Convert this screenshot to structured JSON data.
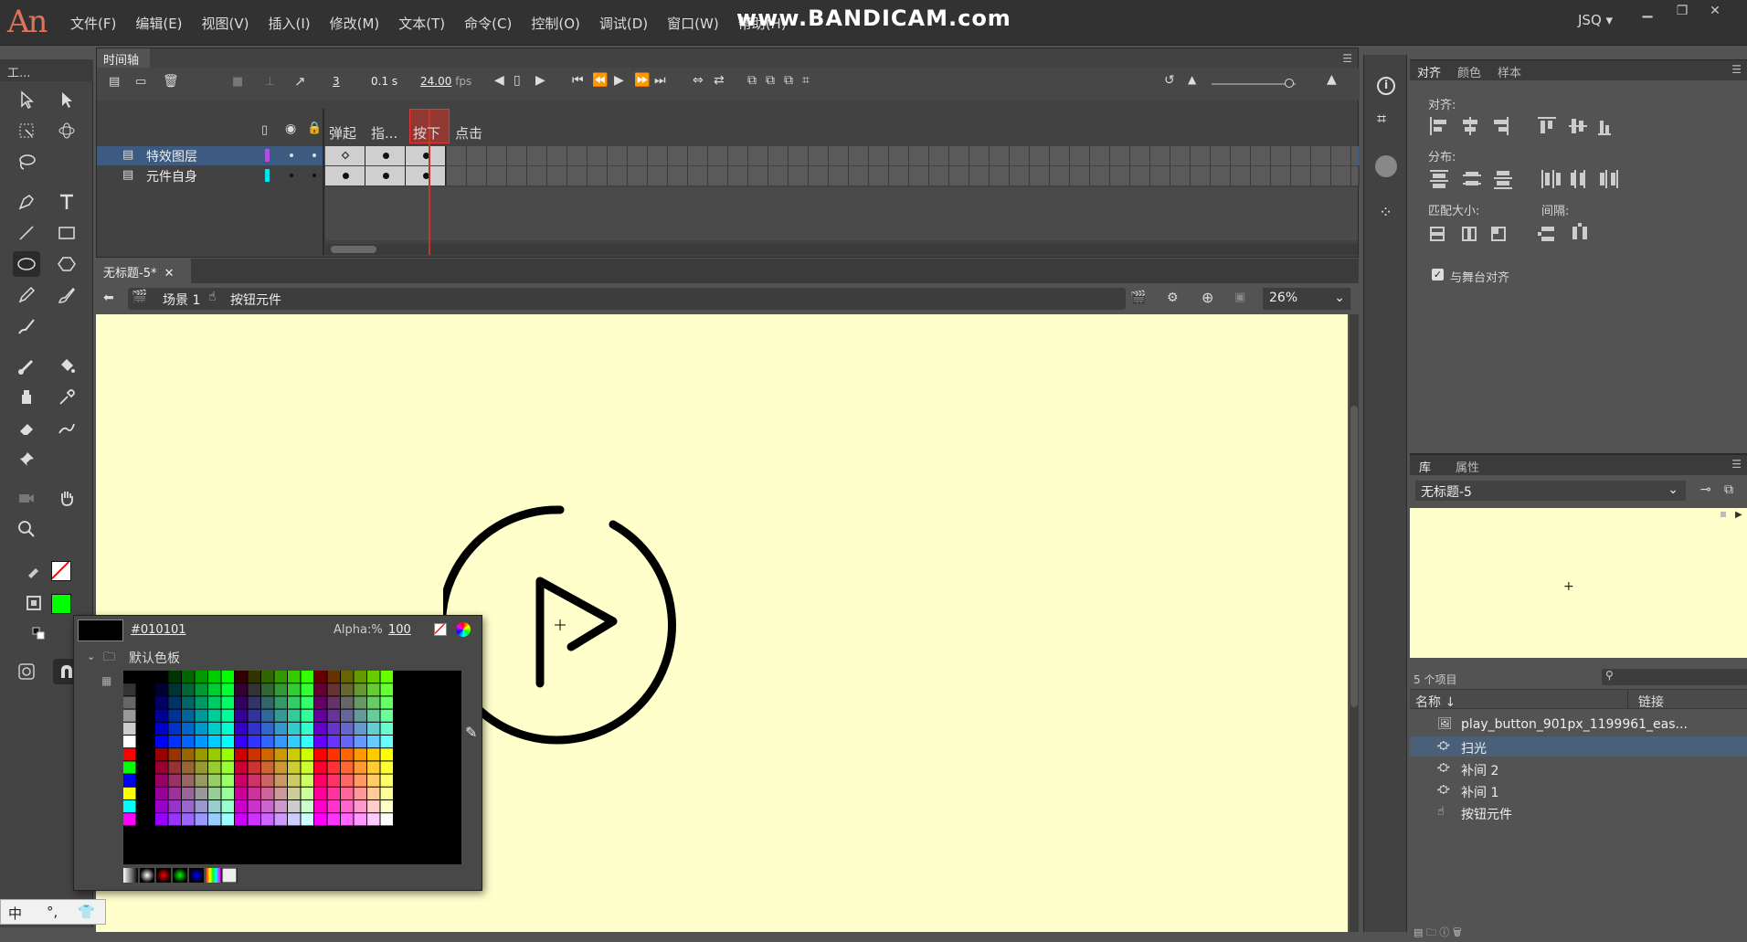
{
  "menubar": {
    "logo": "An",
    "items": [
      "文件(F)",
      "编辑(E)",
      "视图(V)",
      "插入(I)",
      "修改(M)",
      "文本(T)",
      "命令(C)",
      "控制(O)",
      "调试(D)",
      "窗口(W)",
      "帮助(H)"
    ],
    "watermark": "www.BANDICAM.com",
    "user": "JSQ"
  },
  "tools": {
    "header": "工..."
  },
  "timeline": {
    "tab": "时间轴",
    "current_frame": "3",
    "time": "0.1 s",
    "fps": "24.00",
    "fps_unit": "fps",
    "frame_labels": [
      "弹起",
      "指...",
      "按下",
      "点击"
    ],
    "layers": [
      {
        "name": "特效图层",
        "selected": true,
        "color": "#b050e0"
      },
      {
        "name": "元件自身",
        "selected": false,
        "color": "#00e5ee"
      }
    ]
  },
  "document": {
    "tab": "无标题-5*",
    "scene": "场景 1",
    "symbol": "按钮元件",
    "zoom": "26%"
  },
  "swatch": {
    "hex": "#010101",
    "alpha_label": "Alpha:%",
    "alpha": "100",
    "folder": "默认色板"
  },
  "align": {
    "tabs": [
      "对齐",
      "颜色",
      "样本"
    ],
    "align_label": "对齐:",
    "distribute_label": "分布:",
    "match_label": "匹配大小:",
    "spacing_label": "间隔:",
    "stage_align": "与舞台对齐"
  },
  "library": {
    "tabs": [
      "库",
      "属性"
    ],
    "doc": "无标题-5",
    "count": "5 个项目",
    "col_name": "名称",
    "col_link": "链接",
    "items": [
      {
        "name": "play_button_901px_1199961_eas...",
        "icon": "bitmap-icon",
        "selected": false
      },
      {
        "name": "扫光",
        "icon": "graphic-symbol-icon",
        "selected": true
      },
      {
        "name": "补间 2",
        "icon": "graphic-symbol-icon",
        "selected": false
      },
      {
        "name": "补间 1",
        "icon": "graphic-symbol-icon",
        "selected": false
      },
      {
        "name": "按钮元件",
        "icon": "button-symbol-icon",
        "selected": false
      }
    ]
  },
  "ime": {
    "mode": "中",
    "punct": "°,"
  },
  "colors": {
    "stage": "#ffffcc",
    "fill": "#00ff00",
    "accent": "#4a6078"
  }
}
